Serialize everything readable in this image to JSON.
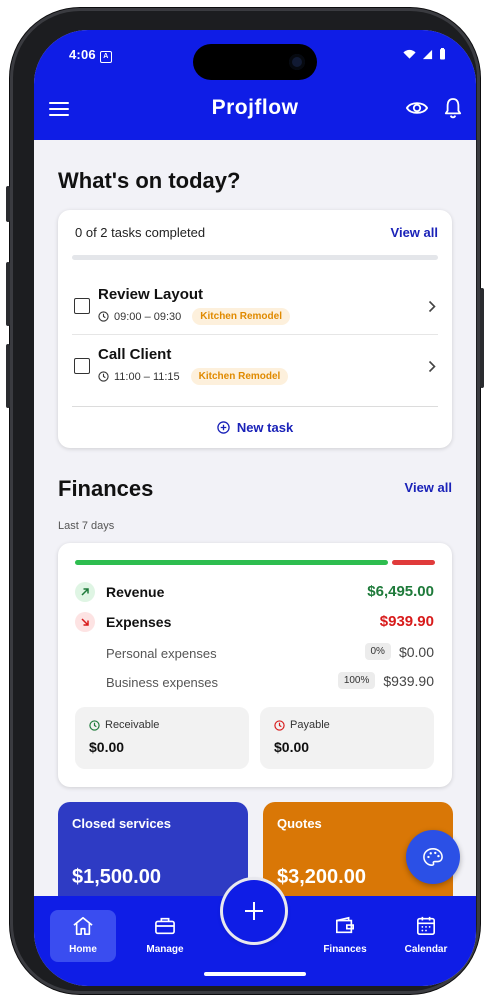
{
  "status": {
    "time": "4:06",
    "badge": "A"
  },
  "header": {
    "title": "Projflow"
  },
  "today": {
    "title": "What's on today?",
    "progress_text": "0 of 2 tasks completed",
    "view_all": "View all",
    "tasks": [
      {
        "title": "Review Layout",
        "time": "09:00 – 09:30",
        "tag": "Kitchen Remodel"
      },
      {
        "title": "Call Client",
        "time": "11:00 – 11:15",
        "tag": "Kitchen Remodel"
      }
    ],
    "new_task": "New task"
  },
  "finances": {
    "title": "Finances",
    "view_all": "View all",
    "period": "Last 7 days",
    "revenue_label": "Revenue",
    "revenue_value": "$6,495.00",
    "expenses_label": "Expenses",
    "expenses_value": "$939.90",
    "personal_label": "Personal expenses",
    "personal_pct": "0%",
    "personal_value": "$0.00",
    "business_label": "Business expenses",
    "business_pct": "100%",
    "business_value": "$939.90",
    "receivable_label": "Receivable",
    "receivable_value": "$0.00",
    "payable_label": "Payable",
    "payable_value": "$0.00",
    "revenue_share": 0.874
  },
  "tiles": {
    "closed_label": "Closed services",
    "closed_value": "$1,500.00",
    "quotes_label": "Quotes",
    "quotes_value": "$3,200.00"
  },
  "nav": {
    "home": "Home",
    "manage": "Manage",
    "finances": "Finances",
    "calendar": "Calendar"
  },
  "colors": {
    "primary": "#0f1de6",
    "revenue": "#1e7a3a",
    "expenses": "#d81b1b",
    "tag_text": "#e08a00",
    "closed_tile": "#2e3bc4",
    "quotes_tile": "#d97706"
  },
  "icons": {
    "menu": "menu-icon",
    "eye": "eye-icon",
    "bell": "bell-icon",
    "clock": "clock-icon",
    "chevron": "chevron-right-icon",
    "plus_circle": "plus-circle-icon",
    "arrow_up_right": "arrow-up-right-icon",
    "arrow_down_right": "arrow-down-right-icon",
    "palette": "palette-icon"
  }
}
